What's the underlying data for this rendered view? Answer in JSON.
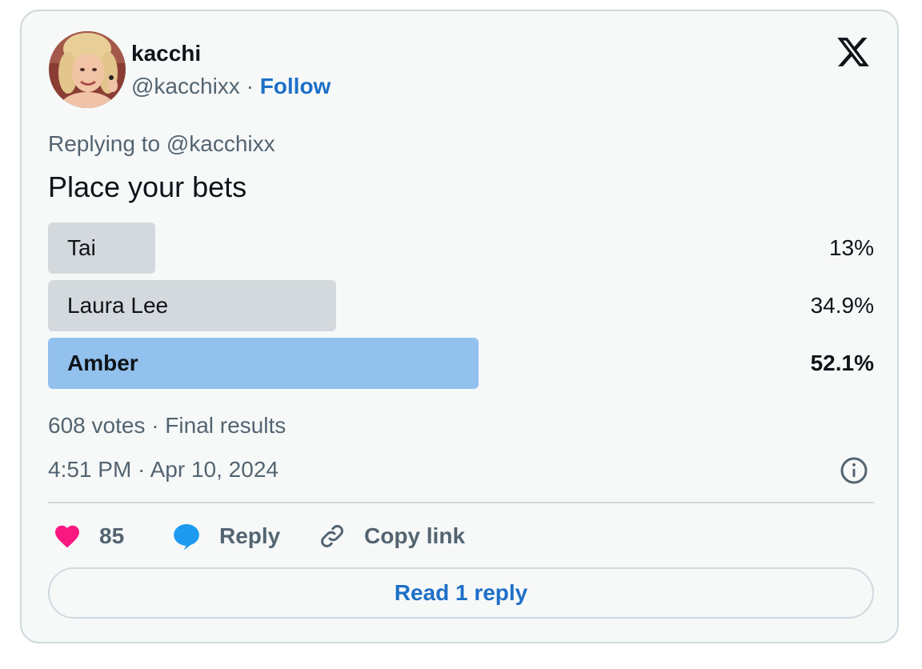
{
  "tweet": {
    "author": {
      "name": "kacchi",
      "handle": "@kacchixx",
      "separator": "·",
      "follow_label": "Follow"
    },
    "brand_icon": "x-logo-icon",
    "reply_context": "Replying to @kacchixx",
    "text": "Place your bets",
    "poll": {
      "options": [
        {
          "label": "Tai",
          "percent": "13%",
          "share": 13.0,
          "winner": false
        },
        {
          "label": "Laura Lee",
          "percent": "34.9%",
          "share": 34.9,
          "winner": false
        },
        {
          "label": "Amber",
          "percent": "52.1%",
          "share": 52.1,
          "winner": true
        }
      ],
      "summary": "608 votes · Final results"
    },
    "timestamp": "4:51 PM · Apr 10, 2024",
    "actions": {
      "like_count": "85",
      "reply_label": "Reply",
      "copy_label": "Copy link"
    },
    "read_replies_label": "Read 1 reply"
  },
  "colors": {
    "accent": "#1d6fc7",
    "like": "#f91880",
    "reply_icon": "#1d9bf0",
    "bar_default": "#d4d9dd",
    "bar_winner": "#93c1ee",
    "muted_text": "#536471",
    "card_bg": "#f7f9f9"
  }
}
